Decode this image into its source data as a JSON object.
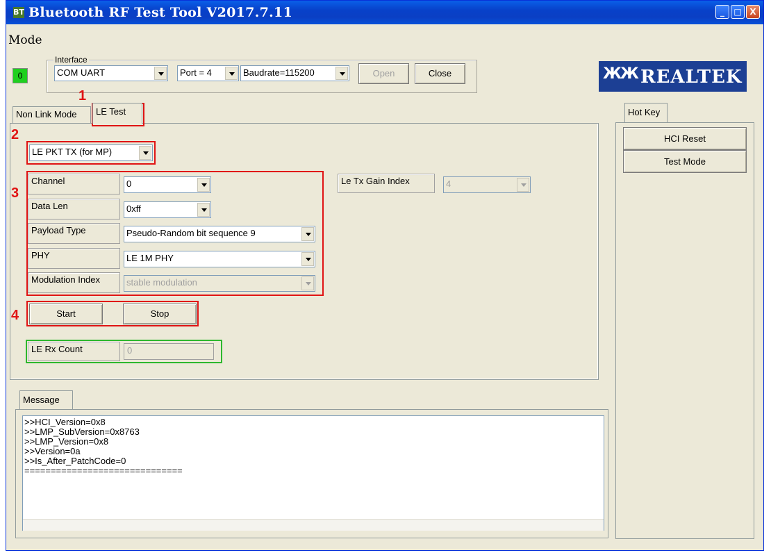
{
  "window": {
    "title": "Bluetooth RF Test Tool V2017.7.11",
    "app_icon": "BT"
  },
  "titlebar_buttons": {
    "minimize": "_",
    "maximize": "□",
    "close": "X"
  },
  "menu": {
    "mode": "Mode"
  },
  "indicator": {
    "value": "0",
    "color": "#1fd01f"
  },
  "interface": {
    "label": "Interface",
    "com": "COM UART",
    "port": "Port = 4",
    "baudrate": "Baudrate=115200",
    "open": "Open",
    "close": "Close"
  },
  "logo": {
    "mark": "ЖЖ",
    "text": "REALTEK"
  },
  "tabs": {
    "non_link": "Non Link Mode",
    "le_test": "LE Test"
  },
  "mode_select": "LE PKT TX (for MP)",
  "fields": {
    "channel": {
      "label": "Channel",
      "value": "0"
    },
    "data_len": {
      "label": "Data Len",
      "value": "0xff"
    },
    "payload_type": {
      "label": "Payload Type",
      "value": "Pseudo-Random bit sequence 9"
    },
    "phy": {
      "label": "PHY",
      "value": "LE 1M PHY"
    },
    "modulation_index": {
      "label": "Modulation Index",
      "value": "stable modulation"
    }
  },
  "gain": {
    "label": "Le Tx Gain Index",
    "value": "4"
  },
  "buttons": {
    "start": "Start",
    "stop": "Stop"
  },
  "rx_count": {
    "label": "LE Rx Count",
    "value": "0"
  },
  "hotkey": {
    "tab": "Hot Key",
    "hci_reset": "HCI Reset",
    "test_mode": "Test Mode"
  },
  "message": {
    "tab": "Message",
    "lines": [
      ">>HCI_Version=0x8",
      ">>LMP_SubVersion=0x8763",
      ">>LMP_Version=0x8",
      ">>Version=0a",
      ">>Is_After_PatchCode=0",
      "=============================="
    ]
  },
  "annotations": {
    "m1": "1",
    "m2": "2",
    "m3": "3",
    "m4": "4"
  },
  "colors": {
    "highlight_red": "#e01414",
    "highlight_green": "#2eb82e",
    "title_blue": "#0a3fc4"
  }
}
